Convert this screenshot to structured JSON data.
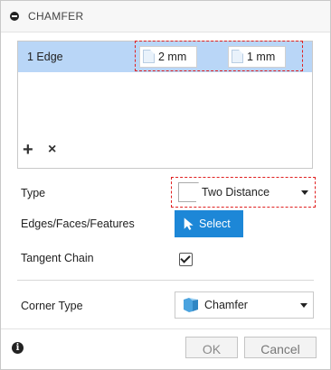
{
  "header": {
    "title": "CHAMFER"
  },
  "selection_list": {
    "rows": [
      {
        "label": "1 Edge",
        "distance_one": "2 mm",
        "distance_two": "1 mm"
      }
    ],
    "add_symbol": "+",
    "remove_symbol": "×"
  },
  "form": {
    "type_label": "Type",
    "type_value": "Two Distance",
    "edges_label": "Edges/Faces/Features",
    "select_button": "Select",
    "tangent_chain_label": "Tangent Chain",
    "tangent_chain_checked": true,
    "corner_type_label": "Corner Type",
    "corner_type_value": "Chamfer"
  },
  "footer": {
    "info_symbol": "i",
    "ok_label": "OK",
    "cancel_label": "Cancel"
  },
  "colors": {
    "selected_row": "#b9d6f7",
    "select_button": "#1d87d7",
    "highlight_dashes": "#e02020"
  }
}
